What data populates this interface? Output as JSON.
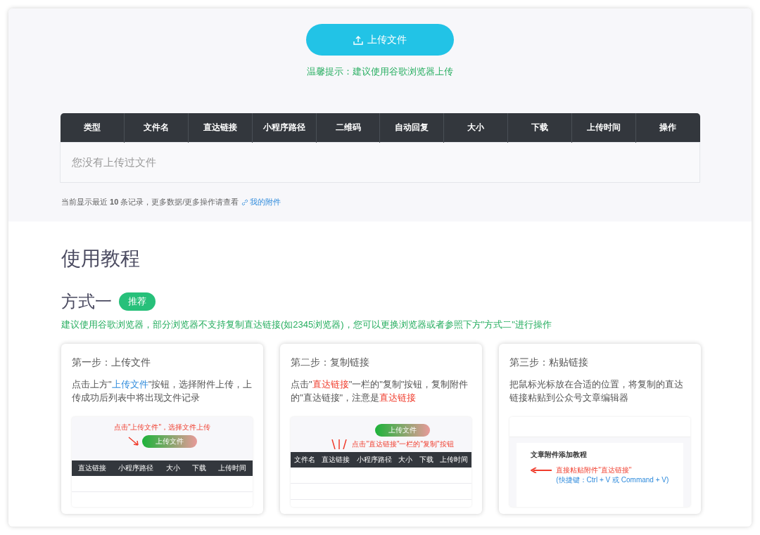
{
  "upload": {
    "button": "上传文件",
    "tip": "温馨提示：建议使用谷歌浏览器上传"
  },
  "table": {
    "columns": [
      "类型",
      "文件名",
      "直达链接",
      "小程序路径",
      "二维码",
      "自动回复",
      "大小",
      "下载",
      "上传时间",
      "操作"
    ],
    "empty": "您没有上传过文件"
  },
  "footer_note": {
    "text": "当前显示最近 **10** 条记录，更多数据/更多操作请查看",
    "link": "我的附件"
  },
  "tutorial": {
    "title": "使用教程",
    "method": {
      "title": "方式一",
      "badge": "推荐",
      "note": "建议使用谷歌浏览器，部分浏览器不支持复制直达链接(如2345浏览器)，您可以更换浏览器或者参照下方\"方式二\"进行操作"
    },
    "steps": [
      {
        "title": "第一步：上传文件",
        "description": [
          {
            "text": "点击上方\""
          },
          {
            "text": "上传文件",
            "color": "#2f8bdc"
          },
          {
            "text": "\"按钮，选择附件上传，上传成功后列表中将出现文件记录"
          }
        ],
        "preview": {
          "kind": "upload",
          "annotation": "点击\"上传文件\"，选择文件上传",
          "button": "上传文件",
          "columns": [
            "直达链接",
            "小程序路径",
            "大小",
            "下载",
            "上传时间"
          ]
        }
      },
      {
        "title": "第二步：复制链接",
        "description": [
          {
            "text": "点击\""
          },
          {
            "text": "直达链接",
            "color": "#f03c2c"
          },
          {
            "text": "\"一栏的\"复制\"按钮，复制附件的\"直达链接\"，注意是"
          },
          {
            "text": "直达链接",
            "color": "#f03c2c"
          }
        ],
        "preview": {
          "kind": "copy",
          "annotation": "点击\"直达链接\"一栏的\"复制\"按钮",
          "button": "上传文件",
          "columns": [
            "文件名",
            "直达链接",
            "小程序路径",
            "大小",
            "下载",
            "上传时间"
          ]
        }
      },
      {
        "title": "第三步：粘贴链接",
        "description": [
          {
            "text": "把鼠标光标放在合适的位置，将复制的直达链接粘贴到公众号文章编辑器"
          }
        ],
        "preview": {
          "kind": "paste",
          "heading": "文章附件添加教程",
          "annotation": "直接粘贴附件\"直达链接\"",
          "hint": "(快捷键：Ctrl + V 或 Command + V)"
        }
      }
    ]
  }
}
